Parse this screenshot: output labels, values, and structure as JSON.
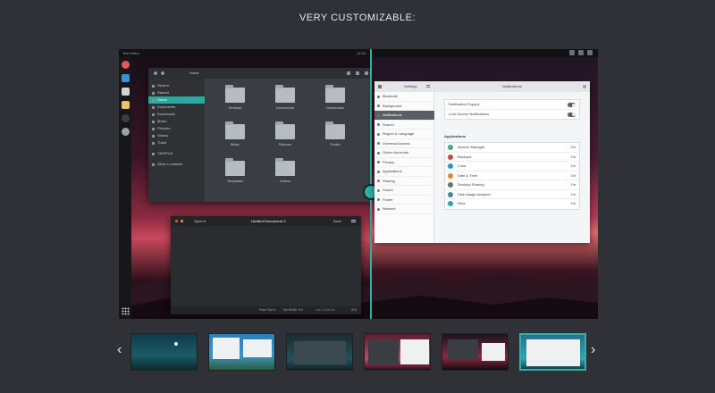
{
  "heading": "VERY CUSTOMIZABLE:",
  "desktop": {
    "app_name": "Text Editor",
    "clock": "10:29"
  },
  "file_manager": {
    "path": "Home",
    "sidebar": [
      "Recent",
      "Starred",
      "Home",
      "Documents",
      "Downloads",
      "Music",
      "Pictures",
      "Videos",
      "Trash",
      "TMOFILE",
      "Other Locations"
    ],
    "folders": [
      "Desktop",
      "Documents",
      "Downloads",
      "Music",
      "Pictures",
      "Public",
      "Templates",
      "Videos"
    ]
  },
  "text_editor": {
    "open_label": "Open ▾",
    "title": "Untitled Document 1",
    "save_label": "Save",
    "footer_mode": "Plain Text ▾",
    "footer_tab": "Tab Width: 8 ▾",
    "footer_pos": "Ln 1, Col 1 ▾",
    "footer_ins": "INS"
  },
  "settings": {
    "title": "Settings",
    "panel_title": "Notifications",
    "sidebar": [
      "Bluetooth",
      "Background",
      "Notifications",
      "Search",
      "Region & Language",
      "Universal Access",
      "Online Accounts",
      "Privacy",
      "Applications",
      "Sharing",
      "Sound",
      "Power",
      "Network"
    ],
    "toggles": [
      "Notification Popups",
      "Lock Screen Notifications"
    ],
    "applications_title": "Applications",
    "apps": [
      {
        "name": "Archive Manager",
        "state": "On",
        "color": "#3fae7a"
      },
      {
        "name": "Backups",
        "state": "On",
        "color": "#c9453d"
      },
      {
        "name": "Color",
        "state": "On",
        "color": "#2b8fd6"
      },
      {
        "name": "Date & Time",
        "state": "On",
        "color": "#e08a2f"
      },
      {
        "name": "Desktop Sharing",
        "state": "On",
        "color": "#6c7278"
      },
      {
        "name": "Disk Usage Analyzer",
        "state": "On",
        "color": "#4a7fb5"
      },
      {
        "name": "Files",
        "state": "On",
        "color": "#2aa9a0"
      }
    ]
  },
  "nav": {
    "prev": "‹",
    "next": "›"
  },
  "colors": {
    "accent": "#2fb3a9",
    "background": "#2f3136"
  }
}
